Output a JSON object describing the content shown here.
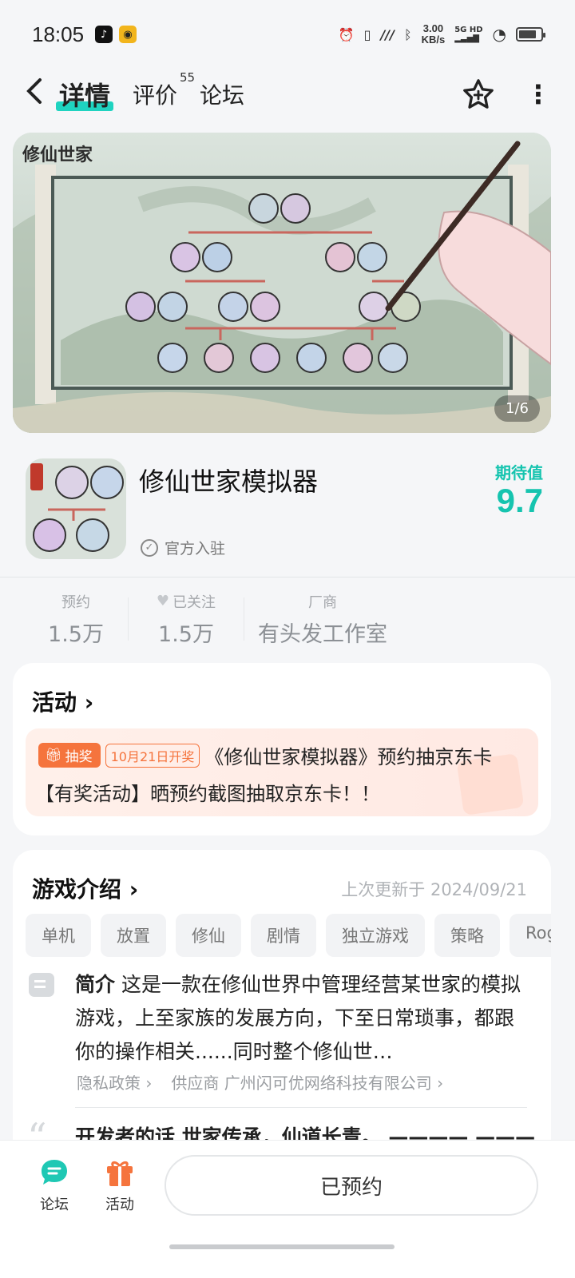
{
  "status_bar": {
    "time": "18:05",
    "net_speed_value": "3.00",
    "net_speed_unit": "KB/s",
    "signal_label": "5G HD",
    "icons": [
      "tiktok-icon",
      "game-app-icon",
      "alarm-icon",
      "vibrate-icon",
      "nfc-icon",
      "bluetooth-icon",
      "signal-icon",
      "wifi-icon",
      "battery-icon"
    ]
  },
  "nav": {
    "tabs": [
      {
        "label": "详情",
        "active": true
      },
      {
        "label": "评价",
        "badge": "55"
      },
      {
        "label": "论坛"
      }
    ]
  },
  "banner": {
    "title": "修仙世家",
    "page_indicator": "1/6"
  },
  "game": {
    "name": "修仙世家模拟器",
    "official_label": "官方入驻",
    "expect_label": "期待值",
    "expect_score": "9.7",
    "accent_color": "#16c4af"
  },
  "stats": [
    {
      "key": "预约",
      "value": "1.5万"
    },
    {
      "key": "已关注",
      "value": "1.5万",
      "icon": "heart-icon"
    },
    {
      "key": "厂商",
      "value": "有头发工作室"
    }
  ],
  "activity": {
    "title": "活动",
    "tag_prize": "抽奖",
    "tag_date": "10月21日开奖",
    "item_title": "《修仙世家模拟器》预约抽京东卡",
    "item_desc": "【有奖活动】晒预约截图抽取京东卡！！"
  },
  "intro": {
    "title": "游戏介绍",
    "updated": "上次更新于 2024/09/21",
    "tags": [
      "单机",
      "放置",
      "修仙",
      "剧情",
      "独立游戏",
      "策略",
      "Roguelike"
    ],
    "summary_label": "简介",
    "summary_text": "这是一款在修仙世界中管理经营某世家的模拟游戏，上至家族的发展方向，下至日常琐事，都跟你的操作相关......同时整个修仙世…",
    "privacy": "隐私政策",
    "supplier": "供应商 广州闪可优网络科技有限公司",
    "dev_words": "开发者的话 世家传承，仙道长青。 ———— ———"
  },
  "bottom": {
    "forum_label": "论坛",
    "activity_label": "活动",
    "reserve_button": "已预约"
  }
}
